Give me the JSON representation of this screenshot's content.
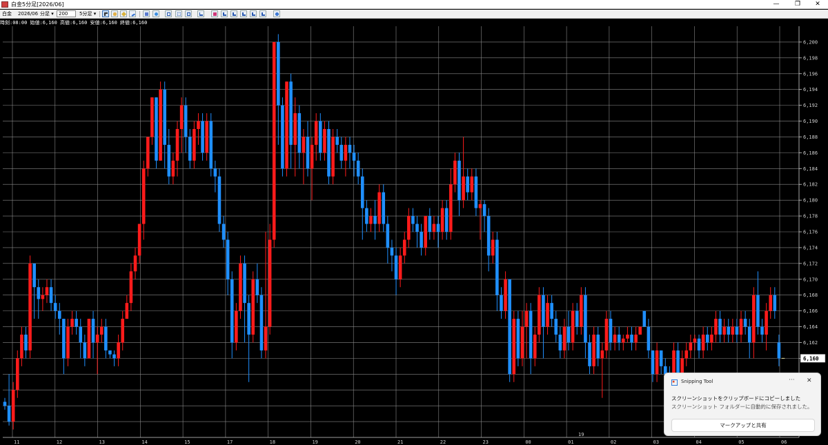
{
  "window": {
    "title": "白金5分足[2026/06]",
    "minimize": "—",
    "maximize": "❐",
    "close": "✕"
  },
  "toolbar": {
    "instrument": "白金",
    "contract": "2026/06",
    "bar_type": "分足",
    "count": "200",
    "interval": "5分足"
  },
  "info_line": "時刻:08:00 始値:6,160 高値:6,160 安値:6,160 終値:6,160",
  "chart_data": {
    "type": "candlestick",
    "ylim": [
      6150,
      6202
    ],
    "y_ticks": [
      "6,200",
      "6,198",
      "6,196",
      "6,194",
      "6,192",
      "6,190",
      "6,188",
      "6,186",
      "6,184",
      "6,182",
      "6,180",
      "6,178",
      "6,176",
      "6,174",
      "6,172",
      "6,170",
      "6,168",
      "6,166",
      "6,164",
      "6,162",
      "6,160",
      "6,158",
      "6,156",
      "6,154",
      "6,152"
    ],
    "current_price": "6,160",
    "x_ticks": [
      "11",
      "12",
      "13",
      "14",
      "15",
      "17",
      "18",
      "19",
      "20",
      "21",
      "22",
      "23",
      "00",
      "01",
      "02",
      "03",
      "04",
      "05",
      "06"
    ],
    "date_marker": "19",
    "colors": {
      "up": "#ff1b1b",
      "down": "#1f8fff",
      "doji": "#e8e2a0",
      "grid": "#8a8a8a",
      "axis_text": "#d0d0d0"
    },
    "candles": [
      [
        6154.5,
        6154.0,
        6153.5,
        6155.0
      ],
      [
        6154.0,
        6152.0,
        6151.5,
        6158.0
      ],
      [
        6152.0,
        6156.0,
        6151.0,
        6157.0
      ],
      [
        6156.0,
        6160.0,
        6155.0,
        6161.0
      ],
      [
        6160.0,
        6163.0,
        6159.0,
        6164.0
      ],
      [
        6163.0,
        6161.0,
        6160.0,
        6164.0
      ],
      [
        6161.0,
        6172.0,
        6160.0,
        6173.0
      ],
      [
        6172.0,
        6169.0,
        6165.0,
        6170.0
      ],
      [
        6169.0,
        6167.5,
        6165.0,
        6170.0
      ],
      [
        6167.5,
        6168.0,
        6166.0,
        6169.0
      ],
      [
        6168.0,
        6169.0,
        6167.0,
        6170.0
      ],
      [
        6169.0,
        6167.0,
        6166.0,
        6170.0
      ],
      [
        6167.0,
        6166.0,
        6165.0,
        6168.0
      ],
      [
        6166.0,
        6165.0,
        6163.0,
        6167.0
      ],
      [
        6165.0,
        6160.0,
        6158.0,
        6165.0
      ],
      [
        6160.0,
        6164.0,
        6159.0,
        6165.0
      ],
      [
        6164.0,
        6165.0,
        6163.0,
        6166.0
      ],
      [
        6165.0,
        6164.0,
        6163.0,
        6166.0
      ],
      [
        6164.0,
        6162.0,
        6160.0,
        6165.0
      ],
      [
        6162.0,
        6160.0,
        6159.0,
        6163.0
      ],
      [
        6160.0,
        6165.0,
        6160.0,
        6165.0
      ],
      [
        6165.0,
        6162.0,
        6160.0,
        6166.0
      ],
      [
        6162.0,
        6163.0,
        6158.0,
        6164.0
      ],
      [
        6163.0,
        6164.0,
        6162.0,
        6165.0
      ],
      [
        6164.0,
        6161.0,
        6160.0,
        6165.0
      ],
      [
        6161.0,
        6160.5,
        6160.0,
        6161.0
      ],
      [
        6160.5,
        6160.0,
        6159.0,
        6161.0
      ],
      [
        6160.0,
        6162.0,
        6159.0,
        6163.0
      ],
      [
        6162.0,
        6165.0,
        6161.0,
        6166.0
      ],
      [
        6165.0,
        6167.0,
        6165.0,
        6168.0
      ],
      [
        6167.0,
        6171.0,
        6166.0,
        6172.0
      ],
      [
        6171.0,
        6173.0,
        6170.0,
        6174.0
      ],
      [
        6173.0,
        6177.0,
        6172.0,
        6177.0
      ],
      [
        6177.0,
        6184.0,
        6175.0,
        6185.0
      ],
      [
        6184.0,
        6188.0,
        6183.0,
        6188.0
      ],
      [
        6188.0,
        6193.0,
        6187.0,
        6193.0
      ],
      [
        6193.0,
        6185.0,
        6184.0,
        6193.0
      ],
      [
        6185.0,
        6194.0,
        6185.0,
        6195.0
      ],
      [
        6194.0,
        6187.0,
        6184.0,
        6195.0
      ],
      [
        6187.0,
        6183.0,
        6182.0,
        6189.0
      ],
      [
        6183.0,
        6185.0,
        6182.0,
        6186.0
      ],
      [
        6185.0,
        6189.0,
        6183.0,
        6190.0
      ],
      [
        6189.0,
        6192.0,
        6186.0,
        6193.0
      ],
      [
        6192.0,
        6188.0,
        6186.0,
        6193.0
      ],
      [
        6188.0,
        6185.0,
        6184.0,
        6189.0
      ],
      [
        6185.0,
        6189.0,
        6184.0,
        6190.0
      ],
      [
        6189.0,
        6190.0,
        6187.0,
        6191.0
      ],
      [
        6190.0,
        6186.0,
        6185.0,
        6191.0
      ],
      [
        6186.0,
        6190.0,
        6185.0,
        6191.0
      ],
      [
        6190.0,
        6184.0,
        6183.0,
        6191.0
      ],
      [
        6184.0,
        6183.0,
        6181.0,
        6185.0
      ],
      [
        6183.0,
        6177.0,
        6176.0,
        6184.0
      ],
      [
        6177.0,
        6175.0,
        6174.0,
        6178.0
      ],
      [
        6175.0,
        6170.0,
        6168.0,
        6176.0
      ],
      [
        6170.0,
        6162.0,
        6160.0,
        6171.0
      ],
      [
        6162.0,
        6166.0,
        6161.0,
        6167.0
      ],
      [
        6166.0,
        6172.0,
        6165.0,
        6173.0
      ],
      [
        6172.0,
        6167.0,
        6162.0,
        6173.0
      ],
      [
        6167.0,
        6163.0,
        6157.0,
        6168.0
      ],
      [
        6163.0,
        6170.0,
        6162.0,
        6171.0
      ],
      [
        6170.0,
        6168.0,
        6167.0,
        6172.0
      ],
      [
        6168.0,
        6161.0,
        6160.0,
        6169.0
      ],
      [
        6161.0,
        6164.0,
        6160.0,
        6176.0
      ],
      [
        6164.0,
        6175.0,
        6163.0,
        6177.0
      ],
      [
        6175.0,
        6200.0,
        6174.0,
        6200.0
      ],
      [
        6200.0,
        6192.0,
        6187.0,
        6201.0
      ],
      [
        6192.0,
        6184.0,
        6183.0,
        6193.0
      ],
      [
        6184.0,
        6195.0,
        6183.0,
        6195.0
      ],
      [
        6195.0,
        6187.0,
        6184.0,
        6196.0
      ],
      [
        6187.0,
        6191.0,
        6183.0,
        6193.0
      ],
      [
        6191.0,
        6186.0,
        6184.0,
        6192.0
      ],
      [
        6186.0,
        6188.0,
        6182.0,
        6189.0
      ],
      [
        6188.0,
        6184.0,
        6183.0,
        6190.0
      ],
      [
        6184.0,
        6187.0,
        6180.0,
        6188.0
      ],
      [
        6187.0,
        6190.0,
        6185.0,
        6191.0
      ],
      [
        6190.0,
        6186.0,
        6185.0,
        6191.0
      ],
      [
        6186.0,
        6189.0,
        6185.0,
        6190.0
      ],
      [
        6189.0,
        6183.0,
        6182.0,
        6190.0
      ],
      [
        6183.0,
        6188.0,
        6182.0,
        6189.0
      ],
      [
        6188.0,
        6187.0,
        6186.0,
        6189.0
      ],
      [
        6187.0,
        6185.0,
        6184.0,
        6188.0
      ],
      [
        6185.0,
        6187.0,
        6183.0,
        6188.0
      ],
      [
        6187.0,
        6186.0,
        6184.0,
        6188.0
      ],
      [
        6186.0,
        6185.0,
        6183.0,
        6187.0
      ],
      [
        6185.0,
        6183.0,
        6182.0,
        6186.0
      ],
      [
        6183.0,
        6179.0,
        6175.0,
        6184.0
      ],
      [
        6179.0,
        6177.0,
        6176.0,
        6180.0
      ],
      [
        6177.0,
        6178.0,
        6176.0,
        6179.0
      ],
      [
        6178.0,
        6177.0,
        6175.0,
        6180.0
      ],
      [
        6177.0,
        6181.0,
        6176.0,
        6182.0
      ],
      [
        6181.0,
        6177.0,
        6176.0,
        6182.0
      ],
      [
        6177.0,
        6174.0,
        6172.0,
        6178.0
      ],
      [
        6174.0,
        6173.0,
        6171.0,
        6175.0
      ],
      [
        6173.0,
        6170.0,
        6168.0,
        6174.0
      ],
      [
        6170.0,
        6173.0,
        6169.0,
        6174.0
      ],
      [
        6173.0,
        6175.0,
        6172.0,
        6176.0
      ],
      [
        6175.0,
        6178.0,
        6174.0,
        6179.0
      ],
      [
        6178.0,
        6177.0,
        6176.0,
        6179.0
      ],
      [
        6177.0,
        6176.0,
        6174.0,
        6178.0
      ],
      [
        6176.0,
        6174.0,
        6173.0,
        6177.0
      ],
      [
        6174.0,
        6178.0,
        6173.0,
        6178.0
      ],
      [
        6178.0,
        6176.0,
        6175.0,
        6179.0
      ],
      [
        6176.0,
        6177.0,
        6175.0,
        6178.0
      ],
      [
        6177.0,
        6176.0,
        6174.0,
        6178.0
      ],
      [
        6176.0,
        6179.0,
        6175.0,
        6180.0
      ],
      [
        6179.0,
        6176.0,
        6175.0,
        6180.0
      ],
      [
        6176.0,
        6182.0,
        6175.0,
        6184.0
      ],
      [
        6182.0,
        6185.0,
        6181.0,
        6186.0
      ],
      [
        6185.0,
        6180.0,
        6178.0,
        6186.0
      ],
      [
        6180.0,
        6183.0,
        6179.0,
        6188.0
      ],
      [
        6183.0,
        6181.0,
        6180.0,
        6184.0
      ],
      [
        6181.0,
        6183.0,
        6180.0,
        6184.0
      ],
      [
        6183.0,
        6179.0,
        6178.0,
        6184.0
      ],
      [
        6179.0,
        6179.5,
        6175.0,
        6180.0
      ],
      [
        6179.5,
        6178.0,
        6176.0,
        6180.0
      ],
      [
        6178.0,
        6173.0,
        6171.0,
        6179.0
      ],
      [
        6173.0,
        6175.0,
        6172.0,
        6176.0
      ],
      [
        6175.0,
        6168.0,
        6166.0,
        6176.0
      ],
      [
        6168.0,
        6166.0,
        6165.0,
        6169.0
      ],
      [
        6166.0,
        6170.0,
        6165.0,
        6171.0
      ],
      [
        6170.0,
        6158.0,
        6157.0,
        6170.0
      ],
      [
        6158.0,
        6165.0,
        6157.0,
        6166.0
      ],
      [
        6165.0,
        6160.0,
        6159.0,
        6166.0
      ],
      [
        6160.0,
        6164.0,
        6159.0,
        6166.0
      ],
      [
        6164.0,
        6166.0,
        6160.0,
        6167.0
      ],
      [
        6166.0,
        6160.0,
        6158.0,
        6167.0
      ],
      [
        6160.0,
        6163.0,
        6159.0,
        6164.0
      ],
      [
        6163.0,
        6168.0,
        6162.0,
        6169.0
      ],
      [
        6168.0,
        6164.0,
        6160.0,
        6169.0
      ],
      [
        6164.0,
        6167.0,
        6163.0,
        6168.0
      ],
      [
        6167.0,
        6165.0,
        6164.0,
        6168.0
      ],
      [
        6165.0,
        6163.0,
        6162.0,
        6166.0
      ],
      [
        6163.0,
        6161.0,
        6160.0,
        6164.0
      ],
      [
        6161.0,
        6164.0,
        6160.0,
        6165.0
      ],
      [
        6164.0,
        6162.0,
        6161.0,
        6166.0
      ],
      [
        6162.0,
        6166.0,
        6161.0,
        6167.0
      ],
      [
        6166.0,
        6164.0,
        6163.0,
        6167.0
      ],
      [
        6164.0,
        6168.0,
        6163.0,
        6169.0
      ],
      [
        6168.0,
        6162.0,
        6160.0,
        6169.0
      ],
      [
        6162.0,
        6159.0,
        6158.0,
        6163.0
      ],
      [
        6159.0,
        6163.0,
        6158.0,
        6164.0
      ],
      [
        6163.0,
        6160.0,
        6159.0,
        6164.0
      ],
      [
        6160.0,
        6161.0,
        6155.0,
        6162.0
      ],
      [
        6161.0,
        6165.0,
        6160.0,
        6166.0
      ],
      [
        6165.0,
        6162.0,
        6161.0,
        6166.0
      ],
      [
        6162.0,
        6163.0,
        6161.0,
        6164.0
      ],
      [
        6163.0,
        6162.0,
        6161.0,
        6164.0
      ],
      [
        6162.0,
        6162.5,
        6161.0,
        6163.0
      ],
      [
        6162.5,
        6163.0,
        6162.0,
        6164.0
      ],
      [
        6163.0,
        6162.0,
        6161.0,
        6164.0
      ],
      [
        6162.0,
        6163.0,
        6161.0,
        6164.0
      ],
      [
        6163.0,
        6164.0,
        6163.0,
        6164.0
      ],
      [
        6166.0,
        6164.0,
        6164.0,
        6166.0
      ],
      [
        6164.0,
        6161.0,
        6160.0,
        6165.0
      ],
      [
        6161.0,
        6158.0,
        6157.0,
        6161.0
      ],
      [
        6158.0,
        6161.0,
        6157.0,
        6162.0
      ],
      [
        6161.0,
        6159.0,
        6158.0,
        6161.0
      ],
      [
        6159.0,
        6158.0,
        6157.0,
        6160.0
      ],
      [
        6158.0,
        6157.0,
        6156.0,
        6159.0
      ],
      [
        6157.0,
        6161.0,
        6156.0,
        6162.0
      ],
      [
        6161.0,
        6156.0,
        6155.0,
        6162.0
      ],
      [
        6156.0,
        6160.0,
        6155.0,
        6161.0
      ],
      [
        6160.0,
        6161.0,
        6159.0,
        6162.0
      ],
      [
        6161.0,
        6162.0,
        6160.0,
        6163.0
      ],
      [
        6162.0,
        6162.5,
        6161.0,
        6163.0
      ],
      [
        6162.5,
        6161.0,
        6160.0,
        6163.0
      ],
      [
        6161.0,
        6163.0,
        6160.0,
        6164.0
      ],
      [
        6163.0,
        6162.0,
        6161.0,
        6164.0
      ],
      [
        6162.0,
        6163.0,
        6161.0,
        6164.0
      ],
      [
        6163.0,
        6165.0,
        6162.0,
        6166.0
      ],
      [
        6165.0,
        6163.0,
        6162.0,
        6166.0
      ],
      [
        6163.0,
        6164.0,
        6162.0,
        6165.0
      ],
      [
        6164.0,
        6163.0,
        6162.0,
        6165.0
      ],
      [
        6163.0,
        6164.0,
        6162.0,
        6165.0
      ],
      [
        6164.0,
        6163.0,
        6162.0,
        6165.0
      ],
      [
        6163.0,
        6165.0,
        6162.0,
        6166.0
      ],
      [
        6165.0,
        6164.0,
        6163.0,
        6166.0
      ],
      [
        6164.0,
        6162.0,
        6160.0,
        6165.0
      ],
      [
        6162.0,
        6168.0,
        6160.0,
        6169.0
      ],
      [
        6168.0,
        6164.0,
        6163.0,
        6171.0
      ],
      [
        6164.0,
        6163.0,
        6162.0,
        6165.0
      ],
      [
        6163.0,
        6166.0,
        6161.0,
        6167.0
      ],
      [
        6166.0,
        6168.0,
        6165.0,
        6169.0
      ],
      [
        6168.0,
        6166.0,
        6165.0,
        6169.0
      ],
      [
        6162.0,
        6160.0,
        6159.0,
        6163.0
      ],
      [
        6160.0,
        6160.0,
        6160.0,
        6160.0
      ]
    ]
  },
  "toast": {
    "app_name": "Snipping Tool",
    "more": "···",
    "close": "✕",
    "line1": "スクリーンショットをクリップボードにコピーしました",
    "line2": "スクリーンショット フォルダーに自動的に保存されました。",
    "action": "マークアップと共有"
  }
}
